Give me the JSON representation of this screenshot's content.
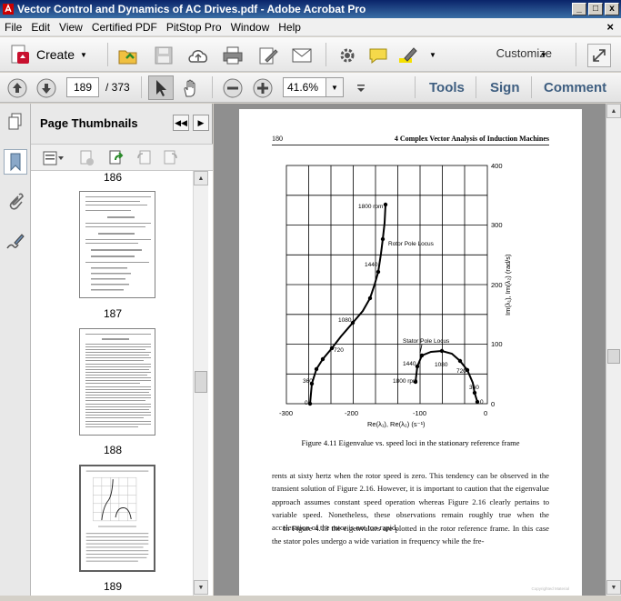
{
  "window": {
    "title": "Vector Control and Dynamics of AC Drives.pdf - Adobe Acrobat Pro",
    "min_label": "_",
    "max_label": "□",
    "close_label": "x"
  },
  "menu": {
    "items": [
      "File",
      "Edit",
      "View",
      "Certified PDF",
      "PitStop Pro",
      "Window",
      "Help"
    ],
    "close_doc": "×"
  },
  "toolbar": {
    "create_label": "Create",
    "customize_label": "Customize"
  },
  "nav": {
    "current_page": "189",
    "total_pages": "/ 373",
    "zoom_value": "41.6%"
  },
  "tabs": {
    "tools": "Tools",
    "sign": "Sign",
    "comment": "Comment"
  },
  "thumbnails": {
    "title": "Page Thumbnails",
    "labels": [
      "186",
      "187",
      "188",
      "189"
    ]
  },
  "page": {
    "header_left": "180",
    "header_right": "4 Complex Vector Analysis of Induction Machines",
    "figure_caption": "Figure 4.11 Eigenvalue vs. speed loci in the stationary reference frame",
    "chart": {
      "x_ticks": [
        "-300",
        "-200",
        "-100",
        "0"
      ],
      "y_ticks": [
        "400",
        "300",
        "200",
        "100",
        "0"
      ],
      "xlabel": "Re(λ₁), Re(λ₂)  (s⁻¹)",
      "ylabel": "Im(λ₁), Im(λ₂)  (rad/s)",
      "rotor_label": "Rotor Pole Locus",
      "stator_label": "Stator Pole Locus",
      "rotor_speeds": [
        "1800 rpm",
        "1440",
        "1080",
        "720",
        "360",
        "0"
      ],
      "stator_speeds": [
        "1440",
        "1080",
        "720",
        "360",
        "0",
        "1800 rpm"
      ]
    },
    "para1": "rents at sixty hertz when the rotor speed is zero. This tendency can be observed in the transient solution of Figure 2.16. However, it is important to caution that the eigenvalue approach assumes constant speed operation whereas Figure 2.16 clearly pertains to variable speed. Nonetheless, these observations remain roughly true when the acceleration of the rotor is not too rapid.",
    "para2": "In Figure 4.13 the eigenvalues are plotted in the rotor reference frame. In this case the stator poles undergo a wide variation in frequency while the fre-",
    "footer": "Copyrighted Material"
  }
}
